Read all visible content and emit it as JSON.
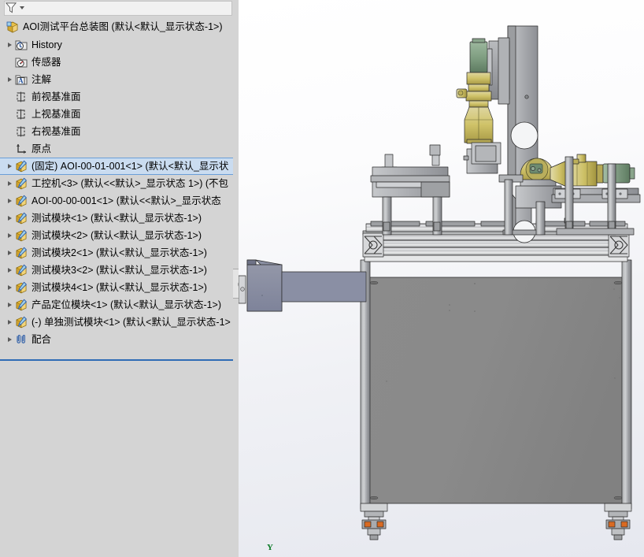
{
  "panel": {
    "filter": {
      "icon": "filter-funnel-icon",
      "dropdown": "chevron-down-icon"
    }
  },
  "tree": {
    "root": {
      "label": "AOI测试平台总装图  (默认<默认_显示状态-1>)",
      "icon": "assembly-icon"
    },
    "items": [
      {
        "label": "History",
        "icon": "history-folder-icon",
        "arrow": true,
        "indent": 1,
        "selected": false
      },
      {
        "label": "传感器",
        "icon": "sensors-folder-icon",
        "arrow": false,
        "indent": 1,
        "selected": false
      },
      {
        "label": "注解",
        "icon": "annotations-folder-icon",
        "arrow": true,
        "indent": 1,
        "selected": false
      },
      {
        "label": "前视基准面",
        "icon": "plane-icon",
        "arrow": false,
        "indent": 1,
        "selected": false
      },
      {
        "label": "上视基准面",
        "icon": "plane-icon",
        "arrow": false,
        "indent": 1,
        "selected": false
      },
      {
        "label": "右视基准面",
        "icon": "plane-icon",
        "arrow": false,
        "indent": 1,
        "selected": false
      },
      {
        "label": "原点",
        "icon": "origin-icon",
        "arrow": false,
        "indent": 1,
        "selected": false
      },
      {
        "label": "(固定) AOI-00-01-001<1>  (默认<默认_显示状",
        "icon": "component-icon",
        "arrow": true,
        "indent": 1,
        "selected": true
      },
      {
        "label": "工控机<3>  (默认<<默认>_显示状态 1>) (不包",
        "icon": "component-icon",
        "arrow": true,
        "indent": 1,
        "selected": false
      },
      {
        "label": "AOI-00-00-001<1>  (默认<<默认>_显示状态",
        "icon": "component-icon",
        "arrow": true,
        "indent": 1,
        "selected": false
      },
      {
        "label": "测试模块<1>  (默认<默认_显示状态-1>)",
        "icon": "component-icon",
        "arrow": true,
        "indent": 1,
        "selected": false
      },
      {
        "label": "测试模块<2>  (默认<默认_显示状态-1>)",
        "icon": "component-icon",
        "arrow": true,
        "indent": 1,
        "selected": false
      },
      {
        "label": "测试模块2<1>  (默认<默认_显示状态-1>)",
        "icon": "component-icon",
        "arrow": true,
        "indent": 1,
        "selected": false
      },
      {
        "label": "测试模块3<2>  (默认<默认_显示状态-1>)",
        "icon": "component-icon",
        "arrow": true,
        "indent": 1,
        "selected": false
      },
      {
        "label": "测试模块4<1>  (默认<默认_显示状态-1>)",
        "icon": "component-icon",
        "arrow": true,
        "indent": 1,
        "selected": false
      },
      {
        "label": "产品定位模块<1>  (默认<默认_显示状态-1>)",
        "icon": "component-icon",
        "arrow": true,
        "indent": 1,
        "selected": false
      },
      {
        "label": "(-) 单独测试模块<1>  (默认<默认_显示状态-1>",
        "icon": "component-icon",
        "arrow": true,
        "indent": 1,
        "selected": false
      },
      {
        "label": "配合",
        "icon": "mates-icon",
        "arrow": true,
        "indent": 1,
        "selected": false
      }
    ]
  },
  "viewport": {
    "axis_indicator": "Y",
    "model_name": "AOI测试平台总装图"
  },
  "colors": {
    "panel_bg": "#d4d4d4",
    "selection_bg": "#cadcf0",
    "selection_border": "#6a9ed8",
    "divider_blue": "#2f6cb5",
    "component_icon_gold": "#e8b63a",
    "component_icon_blue": "#2f5fa8",
    "folder_icon": "#e0e0e0",
    "axis_green": "#0a7a26",
    "steel_gray": "#8f9094",
    "steel_light": "#c9cacd",
    "machine_yellow": "#cfc268",
    "machine_green": "#7d9c7f",
    "cabinet_panel": "#878787"
  }
}
